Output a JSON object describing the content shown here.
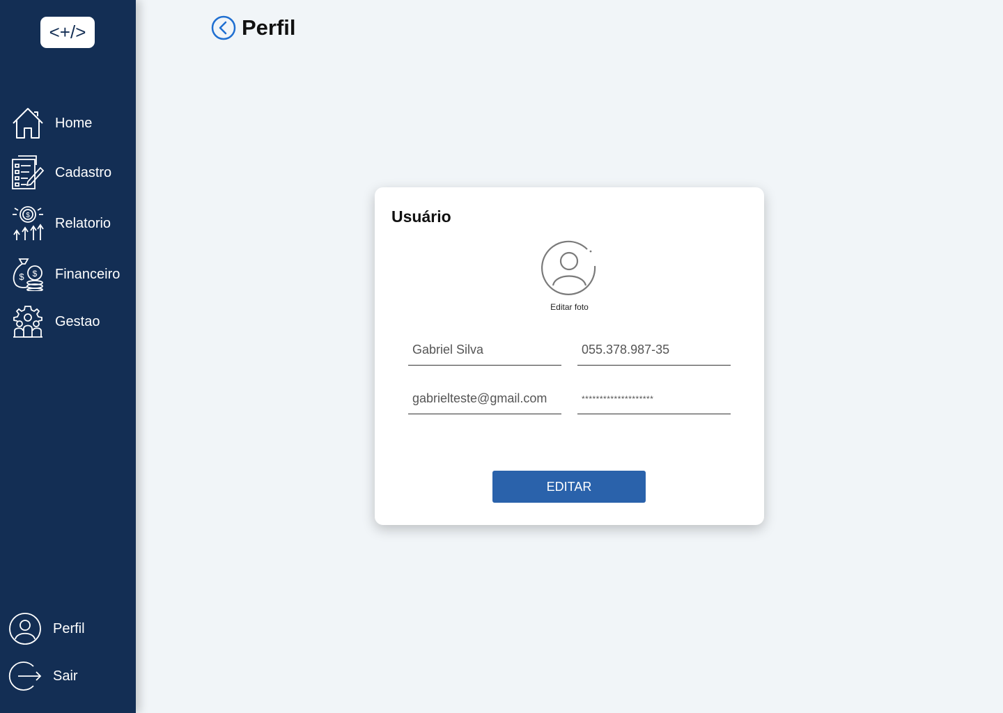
{
  "logo": {
    "text": "<+/>"
  },
  "sidebar": {
    "items": [
      {
        "label": "Home",
        "icon": "home-icon"
      },
      {
        "label": "Cadastro",
        "icon": "form-icon"
      },
      {
        "label": "Relatorio",
        "icon": "report-icon"
      },
      {
        "label": "Financeiro",
        "icon": "money-icon"
      },
      {
        "label": "Gestao",
        "icon": "team-gear-icon"
      }
    ],
    "bottom": [
      {
        "label": "Perfil",
        "icon": "user-icon"
      },
      {
        "label": "Sair",
        "icon": "logout-icon"
      }
    ]
  },
  "header": {
    "title": "Perfil",
    "back_icon": "chevron-left-circle-icon"
  },
  "card": {
    "title": "Usuário",
    "edit_photo": "Editar foto",
    "fields": {
      "name": "Gabriel Silva",
      "cpf": "055.378.987-35",
      "email": "gabrielteste@gmail.com",
      "password": "********************"
    },
    "button": "EDITAR"
  },
  "colors": {
    "sidebar": "#132e54",
    "accent": "#2a62ab",
    "background": "#f1f5f8",
    "back_icon": "#1f6fd1"
  }
}
